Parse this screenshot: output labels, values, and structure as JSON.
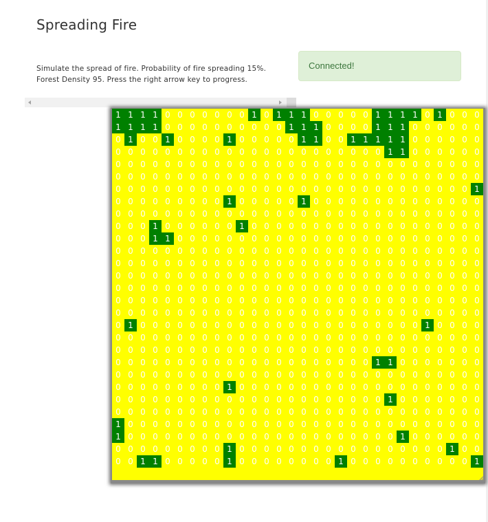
{
  "header": {
    "title": "Spreading Fire"
  },
  "description": {
    "line1": "Simulate the spread of fire. Probability of fire spreading 15%.",
    "line2": "Forest Density 95. Press the right arrow key to progress."
  },
  "status": {
    "message": "Connected!"
  },
  "colors": {
    "tree": "#008000",
    "empty": "#ffff00",
    "cell_text": "#ffffff",
    "alert_bg": "#dff0d8",
    "alert_text": "#3c763d"
  },
  "grid": {
    "symbols": {
      "tree": "1",
      "empty": "0"
    },
    "rows": [
      "111100000001011100000111101000",
      "111100000000001110000111000000",
      "010010000100000110011111000000",
      "000000000000000000000011000000",
      "000000000000000000000000000000",
      "000000000000000000000000000000",
      "000000000000000000000000000001",
      "000000000100000100000000000000",
      "000000000000000000000000000000",
      "000100000010000000000000000000",
      "000110000000000000000000000000",
      "000000000000000000000000000000",
      "000000000000000000000000000000",
      "000000000000000000000000000000",
      "000000000000000000000000000000",
      "000000000000000000000000000000",
      "000000000000000000000000000000",
      "010000000000000000000000010000",
      "000000000000000000000000000000",
      "000000000000000000000000000000",
      "000000000000000000000110000000",
      "000000000000000000000000000000",
      "000000000100000000000000000000",
      "000000000000000000000010000000",
      "000000000000000000000000000000",
      "100000000000000000000000000000",
      "100000000000000000000001000000",
      "000000000100000000000000000100",
      "001100000100000000100000000001"
    ]
  }
}
